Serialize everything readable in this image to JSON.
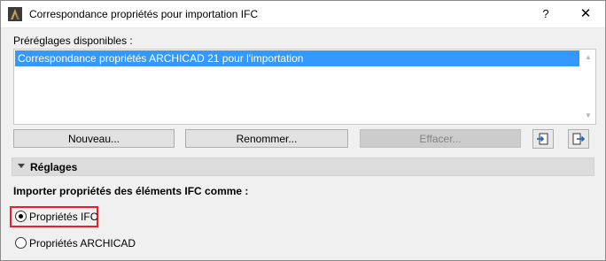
{
  "window": {
    "title": "Correspondance propriétés pour importation IFC",
    "help_glyph": "?",
    "close_glyph": "✕",
    "app_icon": "archicad-icon"
  },
  "presets": {
    "label": "Préréglages disponibles :",
    "items": [
      "Correspondance propriétés ARCHICAD 21 pour l'importation"
    ],
    "selected_index": 0
  },
  "buttons": {
    "new": "Nouveau...",
    "rename": "Renommer...",
    "delete": "Effacer...",
    "import_icon": "import-icon",
    "export_icon": "export-icon"
  },
  "section": {
    "label": "Réglages",
    "expanded": true
  },
  "import_option": {
    "label": "Importer propriétés des éléments IFC comme :",
    "options": [
      {
        "label": "Propriétés IFC",
        "selected": true
      },
      {
        "label": "Propriétés ARCHICAD",
        "selected": false
      }
    ],
    "highlight_color": "#e8202a"
  },
  "colors": {
    "selection": "#3399ff",
    "window_bg": "#f0f0f0"
  }
}
